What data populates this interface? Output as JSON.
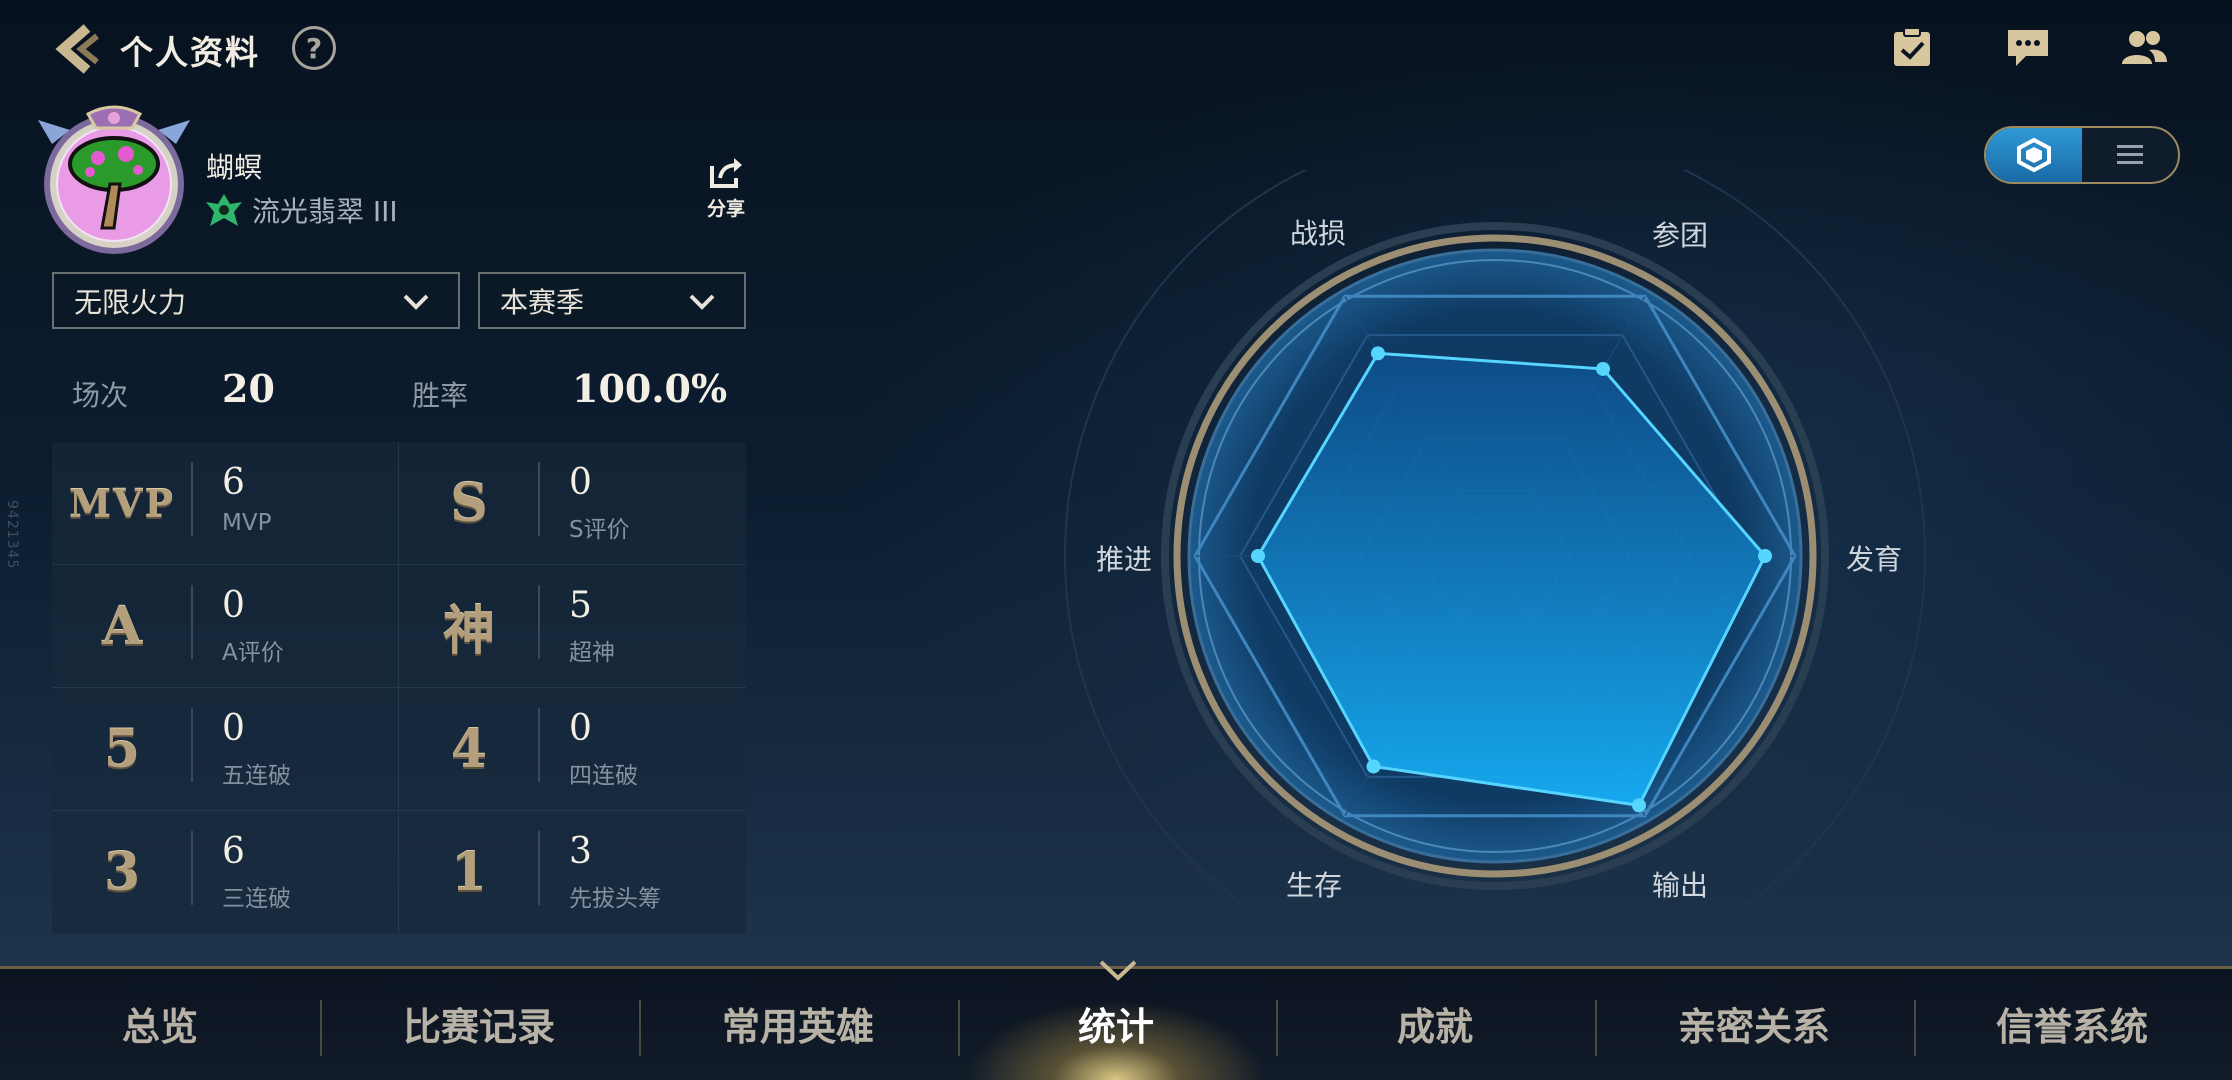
{
  "header": {
    "title": "个人资料",
    "help_label": "?"
  },
  "side_id": "9421345",
  "profile": {
    "name": "蝴螟",
    "rank": "流光翡翠 III",
    "share_label": "分享"
  },
  "filters": {
    "mode": "无限火力",
    "season": "本赛季"
  },
  "summary": {
    "matches_label": "场次",
    "matches_value": "20",
    "winrate_label": "胜率",
    "winrate_value": "100.0%"
  },
  "stats": [
    {
      "badge": "MVP",
      "value": "6",
      "label": "MVP"
    },
    {
      "badge": "S",
      "value": "0",
      "label": "S评价"
    },
    {
      "badge": "A",
      "value": "0",
      "label": "A评价"
    },
    {
      "badge": "神",
      "value": "5",
      "label": "超神"
    },
    {
      "badge": "5",
      "value": "0",
      "label": "五连破"
    },
    {
      "badge": "4",
      "value": "0",
      "label": "四连破"
    },
    {
      "badge": "3",
      "value": "6",
      "label": "三连破"
    },
    {
      "badge": "1",
      "value": "3",
      "label": "先拔头筹"
    }
  ],
  "radar": {
    "axes": [
      "战损",
      "参团",
      "发育",
      "输出",
      "生存",
      "推进"
    ],
    "values": [
      0.78,
      0.72,
      0.9,
      0.96,
      0.81,
      0.79
    ],
    "fill_color": "#1aa6f0",
    "line_color": "#56d6ff"
  },
  "view_toggle": {
    "active": "radar-icon",
    "inactive": "list-icon"
  },
  "tabs": [
    "总览",
    "比赛记录",
    "常用英雄",
    "统计",
    "成就",
    "亲密关系",
    "信誉系统"
  ],
  "active_tab": "统计"
}
